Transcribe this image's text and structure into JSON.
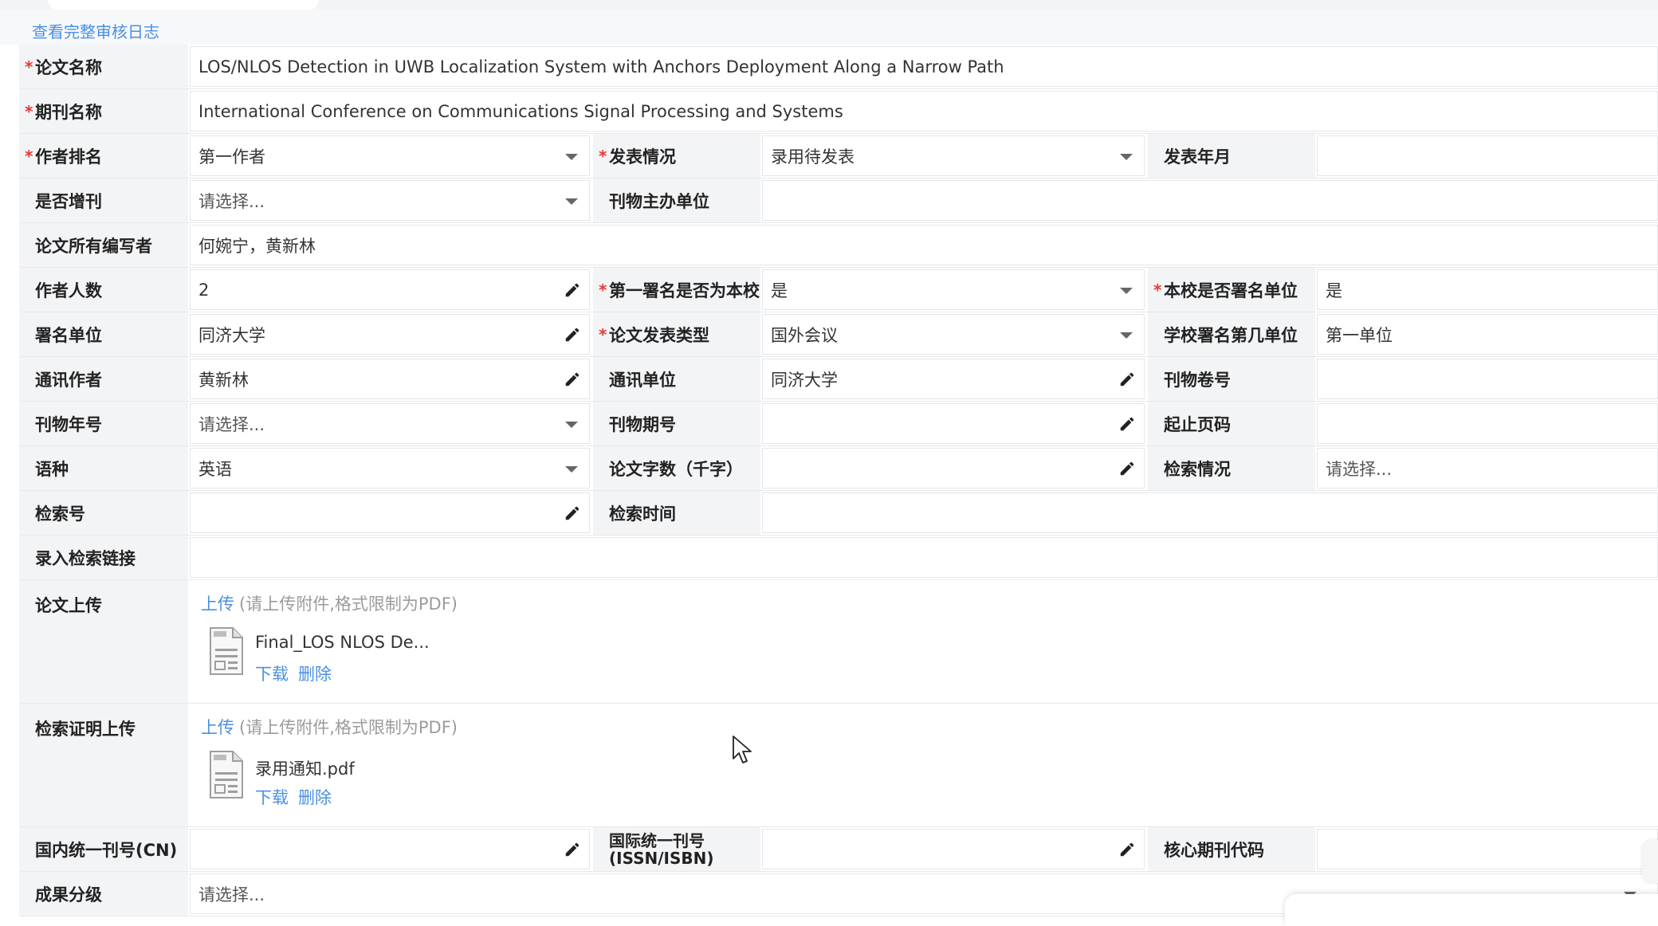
{
  "header": {
    "log_link": "查看完整审核日志"
  },
  "form": {
    "paper_title": {
      "label": "论文名称",
      "value": "LOS/NLOS Detection in UWB Localization System with  Anchors Deployment Along a Narrow Path"
    },
    "journal_name": {
      "label": "期刊名称",
      "value": "International Conference on Communications Signal Processing and Systems"
    },
    "author_rank": {
      "label": "作者排名",
      "value": "第一作者"
    },
    "publish_status": {
      "label": "发表情况",
      "value": "录用待发表"
    },
    "publish_date": {
      "label": "发表年月",
      "value": ""
    },
    "supplement": {
      "label": "是否增刊",
      "value": "请选择..."
    },
    "sponsor": {
      "label": "刊物主办单位",
      "value": ""
    },
    "all_authors": {
      "label": "论文所有编写者",
      "value": "何婉宁，黄新林"
    },
    "author_count": {
      "label": "作者人数",
      "value": "2"
    },
    "first_sign_school": {
      "label": "第一署名是否为本校",
      "value": "是"
    },
    "school_signed": {
      "label": "本校是否署名单位",
      "value": "是"
    },
    "sign_unit": {
      "label": "署名单位",
      "value": "同济大学"
    },
    "paper_type": {
      "label": "论文发表类型",
      "value": "国外会议"
    },
    "school_rank": {
      "label": "学校署名第几单位",
      "value": "第一单位"
    },
    "corr_author": {
      "label": "通讯作者",
      "value": "黄新林"
    },
    "corr_unit": {
      "label": "通讯单位",
      "value": "同济大学"
    },
    "volume": {
      "label": "刊物卷号",
      "value": ""
    },
    "year": {
      "label": "刊物年号",
      "value": "请选择..."
    },
    "issue": {
      "label": "刊物期号",
      "value": ""
    },
    "pages": {
      "label": "起止页码",
      "value": ""
    },
    "language": {
      "label": "语种",
      "value": "英语"
    },
    "word_count": {
      "label": "论文字数（千字）",
      "value": ""
    },
    "index_status": {
      "label": "检索情况",
      "value": "请选择..."
    },
    "index_no": {
      "label": "检索号",
      "value": ""
    },
    "index_time": {
      "label": "检索时间",
      "value": ""
    },
    "index_link": {
      "label": "录入检索链接",
      "value": ""
    },
    "paper_upload": {
      "label": "论文上传",
      "upload_link": "上传",
      "hint": "(请上传附件,格式限制为PDF)",
      "file_name": "Final_LOS NLOS De...",
      "download": "下载",
      "delete": "删除"
    },
    "proof_upload": {
      "label": "检索证明上传",
      "upload_link": "上传",
      "hint": "(请上传附件,格式限制为PDF)",
      "file_name": "录用通知.pdf",
      "download": "下载",
      "delete": "删除"
    },
    "cn": {
      "label": "国内统一刊号(CN)",
      "value": ""
    },
    "issn": {
      "label": "国际统一刊号(ISSN/ISBN)",
      "value": ""
    },
    "core_code": {
      "label": "核心期刊代码",
      "value": ""
    },
    "grade": {
      "label": "成果分级",
      "value": "请选择..."
    }
  },
  "icons": {
    "dropdown": "caret-down-icon",
    "edit": "pencil-icon",
    "file": "pdf-file-icon",
    "pointer": "mouse-cursor-icon"
  },
  "colors": {
    "required_mark": "#e53935",
    "link": "#4a90e2",
    "label_bg": "#f3f4f6"
  }
}
